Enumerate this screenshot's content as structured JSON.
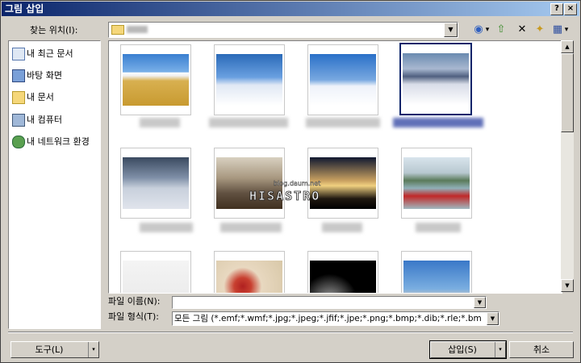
{
  "window": {
    "title": "그림 삽입",
    "help_glyph": "?",
    "close_glyph": "×"
  },
  "lookin": {
    "label": "찾는 위치(I):",
    "dropdown_glyph": "▼"
  },
  "toolbar": {
    "back_glyph": "◉",
    "back_dropdown_glyph": "▾",
    "up_glyph": "⇧",
    "delete_glyph": "✕",
    "newfolder_glyph": "✦",
    "views_glyph": "▦",
    "views_dropdown_glyph": "▾"
  },
  "places": [
    {
      "label": "내 최근 문서",
      "icon": "recent-documents-icon"
    },
    {
      "label": "바탕 화면",
      "icon": "desktop-icon"
    },
    {
      "label": "내 문서",
      "icon": "my-documents-icon"
    },
    {
      "label": "내 컴퓨터",
      "icon": "my-computer-icon"
    },
    {
      "label": "내 네트워크 환경",
      "icon": "network-places-icon"
    }
  ],
  "watermark": {
    "url": "blog.daum.net",
    "name": "HISASTRO"
  },
  "scroll": {
    "up_glyph": "▲",
    "down_glyph": "▼"
  },
  "filename": {
    "label": "파일 이름(N):",
    "value": "",
    "dropdown_glyph": "▼"
  },
  "filetype": {
    "label": "파일 형식(T):",
    "value": "모든 그림 (*.emf;*.wmf;*.jpg;*.jpeg;*.jfif;*.jpe;*.png;*.bmp;*.dib;*.rle;*.bm",
    "dropdown_glyph": "▼"
  },
  "buttons": {
    "tools": "도구(L)",
    "insert": "삽입(S)",
    "cancel": "취소",
    "split_glyph": "▾"
  },
  "colors": {
    "title_start": "#0a246a",
    "title_end": "#a6caf0",
    "selection": "#0a246a",
    "dialog_bg": "#d4d0c8"
  }
}
